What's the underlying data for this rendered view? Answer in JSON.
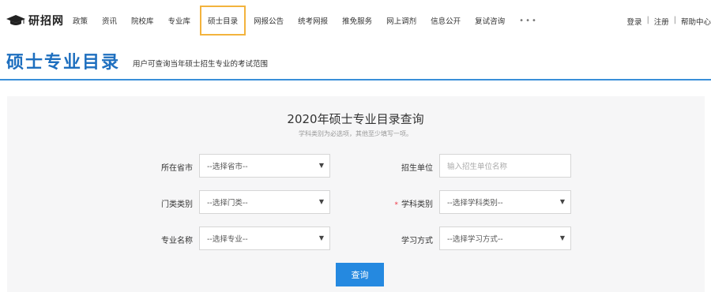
{
  "brand": {
    "logo_text": "研招网",
    "logo_icon": "graduation-cap-icon"
  },
  "nav": {
    "items": [
      {
        "label": "政策"
      },
      {
        "label": "资讯"
      },
      {
        "label": "院校库"
      },
      {
        "label": "专业库"
      },
      {
        "label": "硕士目录",
        "active": true
      },
      {
        "label": "网报公告"
      },
      {
        "label": "统考网报"
      },
      {
        "label": "推免服务"
      },
      {
        "label": "网上调剂"
      },
      {
        "label": "信息公开"
      },
      {
        "label": "复试咨询"
      }
    ],
    "more": "•••"
  },
  "top_right": {
    "login": "登录",
    "register": "注册",
    "help": "帮助中心",
    "sep": "|"
  },
  "header": {
    "title": "硕士专业目录",
    "subtitle": "用户可查询当年硕士招生专业的考试范围"
  },
  "form": {
    "title": "2020年硕士专业目录查询",
    "hint": "学科类别为必选项，其他至少填写一项。",
    "fields": {
      "province": {
        "label": "所在省市",
        "value": "--选择省市--"
      },
      "unit": {
        "label": "招生单位",
        "placeholder": "输入招生单位名称"
      },
      "category": {
        "label": "门类类别",
        "value": "--选择门类--"
      },
      "subject": {
        "label": "学科类别",
        "required": "*",
        "value": "--选择学科类别--"
      },
      "major": {
        "label": "专业名称",
        "value": "--选择专业--"
      },
      "study_mode": {
        "label": "学习方式",
        "value": "--选择学习方式--"
      }
    },
    "submit": "查询",
    "caret": "▼"
  },
  "colors": {
    "accent": "#2589e0",
    "title_blue": "#1e6fbf",
    "active_border": "#f3b33d",
    "panel_bg": "#f6f6f7"
  }
}
